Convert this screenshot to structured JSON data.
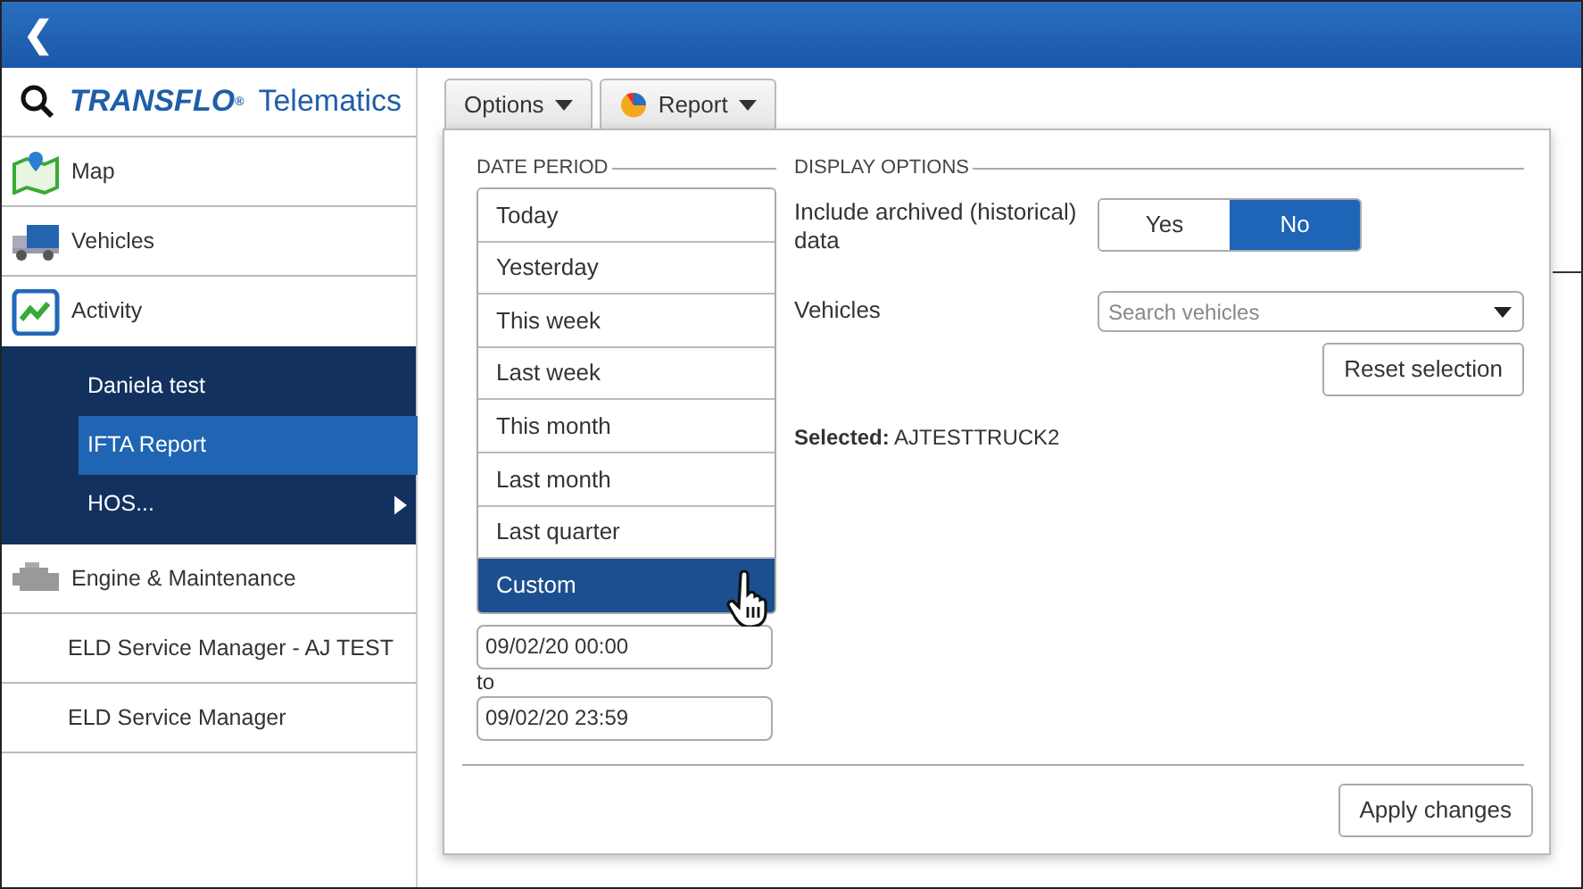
{
  "top_bar": {
    "back": "❮"
  },
  "logo": {
    "brand": "TRANSFLO$^{®}$",
    "product": "Telematics"
  },
  "sidebar": {
    "items": [
      {
        "label": "Map"
      },
      {
        "label": "Vehicles"
      },
      {
        "label": "Activity",
        "expanded": true,
        "children": [
          {
            "label": "Daniela test",
            "selected": false,
            "has_submenu": false
          },
          {
            "label": "IFTA Report",
            "selected": true,
            "has_submenu": false
          },
          {
            "label": "HOS...",
            "selected": false,
            "has_submenu": true
          }
        ]
      },
      {
        "label": "Engine & Maintenance"
      },
      {
        "label": "ELD Service Manager - AJ TEST"
      },
      {
        "label": "ELD Service Manager"
      }
    ]
  },
  "toolbar": {
    "buttons": [
      "Options",
      "Report"
    ]
  },
  "options_panel": {
    "date_period": {
      "title": "DATE PERIOD",
      "options": [
        {
          "label": "Today",
          "selected": false
        },
        {
          "label": "Yesterday",
          "selected": false
        },
        {
          "label": "This week",
          "selected": false
        },
        {
          "label": "Last week",
          "selected": false
        },
        {
          "label": "This month",
          "selected": false
        },
        {
          "label": "Last month",
          "selected": false
        },
        {
          "label": "Last quarter",
          "selected": false
        },
        {
          "label": "Custom",
          "selected": true
        }
      ],
      "from": "09/02/20 00:00",
      "to_label": "to",
      "to": "09/02/20 23:59"
    },
    "display_options": {
      "title": "DISPLAY OPTIONS",
      "archived_label": "Include archived (historical) data",
      "archived_toggle": [
        {
          "label": "Yes",
          "selected": false
        },
        {
          "label": "No",
          "selected": true
        }
      ],
      "vehicles_label": "Vehicles",
      "vehicles_search": {
        "placeholder": "Search vehicles"
      },
      "reset_button": "Reset selection",
      "selected_text": "**Selected:** AJTESTTRUCK2"
    },
    "apply_button": "Apply changes"
  }
}
